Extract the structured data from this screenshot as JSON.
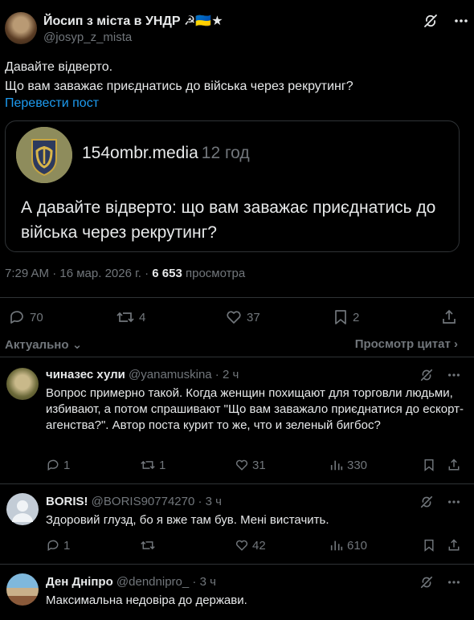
{
  "post": {
    "author_name": "Йосип з міста в УНДР ☭🇺🇦★",
    "author_handle": "@josyp_z_mista",
    "text_line1": "Давайте відверто.",
    "text_line2": "Що вам заважає приєднатись до війська через рекрутинг?",
    "translate_label": "Перевести пост",
    "quote": {
      "source": "154ombr.media",
      "time": "12 год",
      "text": "А давайте відверто: що вам заважає приєднатись до війська через рекрутинг?"
    },
    "time": "7:29 AM",
    "date": "16 мар. 2026 г.",
    "views": "6 653",
    "views_label": "просмотра",
    "counts": {
      "replies": "70",
      "reposts": "4",
      "likes": "37",
      "bookmarks": "2"
    }
  },
  "sort": {
    "left_label": "Актуально",
    "right_label": "Просмотр цитат"
  },
  "replies": [
    {
      "name": "чиназес хули",
      "handle": "@yanamuskina",
      "time": "2 ч",
      "text": "Вопрос примерно такой. Когда женщин похищают для торговли людьми, избивают, а потом спрашивают \"Що вам заважало приєднатися до ескорт-агенства?\". Автор поста курит то же, что и зеленый бигбос?",
      "replies": "1",
      "reposts": "1",
      "likes": "31",
      "views": "330"
    },
    {
      "name": "BORIS!",
      "handle": "@BORIS90774270",
      "time": "3 ч",
      "text": "Здоровий глузд, бо я вже там був. Мені вистачить.",
      "replies": "1",
      "reposts": "",
      "likes": "42",
      "views": "610"
    },
    {
      "name": "Ден Дніпро",
      "handle": "@dendnipro_",
      "time": "3 ч",
      "text": "Максимальна недовіра до держави.",
      "replies": "",
      "reposts": "",
      "likes": "",
      "views": ""
    }
  ],
  "sep": " · "
}
